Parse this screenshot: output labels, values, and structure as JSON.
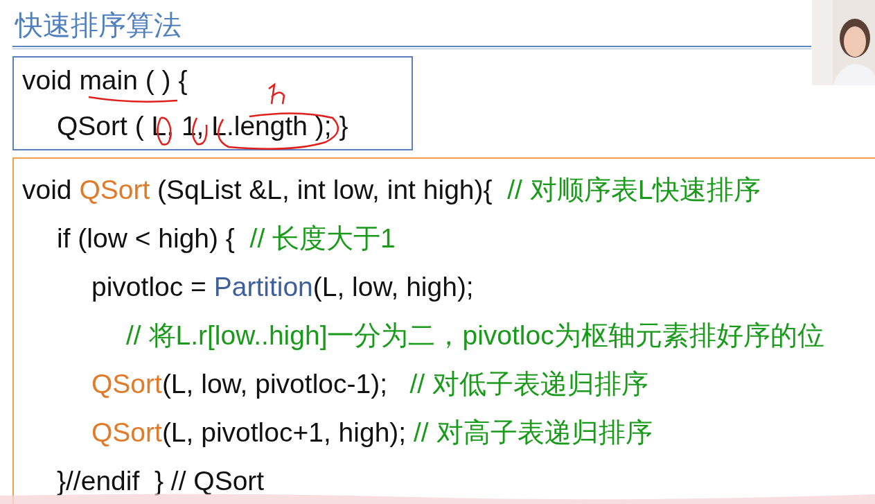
{
  "title": "快速排序算法",
  "main_box": [
    {
      "segments": [
        {
          "kind": "plain",
          "text": "void main ( ) {"
        }
      ],
      "children": [
        {
          "segments": [
            {
              "kind": "plain",
              "text": "QSort ( L, 1, L.length ); }"
            }
          ]
        }
      ]
    }
  ],
  "qsort_box": [
    {
      "segments": [
        {
          "kind": "plain",
          "text": "void "
        },
        {
          "kind": "function",
          "text": "QSort"
        },
        {
          "kind": "plain",
          "text": " (SqList &L, int low, int high){  "
        },
        {
          "kind": "comment",
          "text": "// 对顺序表L快速排序"
        }
      ],
      "children": [
        {
          "segments": [
            {
              "kind": "plain",
              "text": "if (low < high) {  "
            },
            {
              "kind": "comment",
              "text": "// 长度大于1"
            }
          ],
          "children": [
            {
              "segments": [
                {
                  "kind": "plain",
                  "text": "pivotloc = "
                },
                {
                  "kind": "call",
                  "text": "Partition"
                },
                {
                  "kind": "plain",
                  "text": "(L, low, high);"
                }
              ],
              "children": [
                {
                  "segments": [
                    {
                      "kind": "comment",
                      "text": "// 将L.r[low..high]一分为二，pivotloc为枢轴元素排好序的位"
                    }
                  ]
                }
              ]
            },
            {
              "segments": [
                {
                  "kind": "function",
                  "text": "QSort"
                },
                {
                  "kind": "plain",
                  "text": "(L, low, pivotloc-1);   "
                },
                {
                  "kind": "comment",
                  "text": "// 对低子表递归排序"
                }
              ]
            },
            {
              "segments": [
                {
                  "kind": "function",
                  "text": "QSort"
                },
                {
                  "kind": "plain",
                  "text": "(L, pivotloc+1, high); "
                },
                {
                  "kind": "comment",
                  "text": "// 对高子表递归排序"
                }
              ]
            }
          ]
        },
        {
          "segments": [
            {
              "kind": "plain",
              "text": "}//endif  } // QSort"
            }
          ]
        }
      ]
    }
  ]
}
